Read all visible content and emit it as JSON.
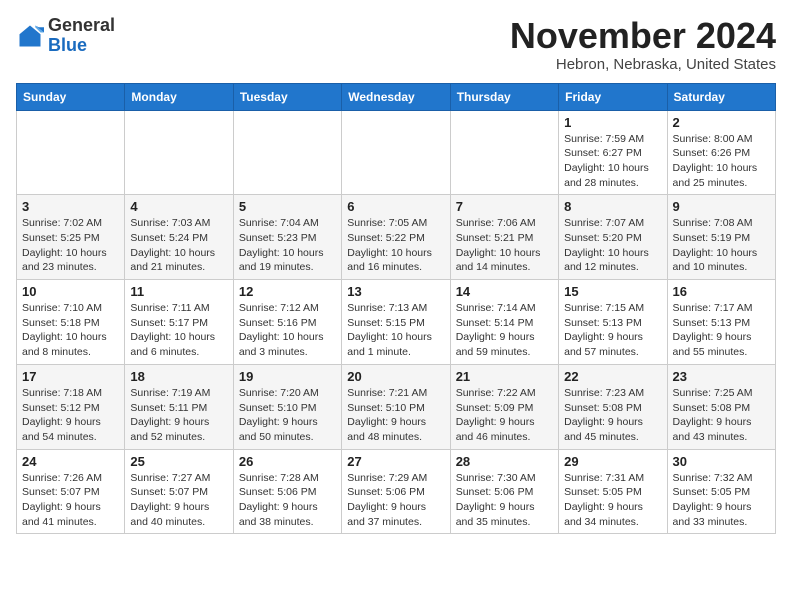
{
  "header": {
    "logo_line1": "General",
    "logo_line2": "Blue",
    "month_title": "November 2024",
    "location": "Hebron, Nebraska, United States"
  },
  "weekdays": [
    "Sunday",
    "Monday",
    "Tuesday",
    "Wednesday",
    "Thursday",
    "Friday",
    "Saturday"
  ],
  "weeks": [
    [
      {
        "day": "",
        "info": ""
      },
      {
        "day": "",
        "info": ""
      },
      {
        "day": "",
        "info": ""
      },
      {
        "day": "",
        "info": ""
      },
      {
        "day": "",
        "info": ""
      },
      {
        "day": "1",
        "info": "Sunrise: 7:59 AM\nSunset: 6:27 PM\nDaylight: 10 hours\nand 28 minutes."
      },
      {
        "day": "2",
        "info": "Sunrise: 8:00 AM\nSunset: 6:26 PM\nDaylight: 10 hours\nand 25 minutes."
      }
    ],
    [
      {
        "day": "3",
        "info": "Sunrise: 7:02 AM\nSunset: 5:25 PM\nDaylight: 10 hours\nand 23 minutes."
      },
      {
        "day": "4",
        "info": "Sunrise: 7:03 AM\nSunset: 5:24 PM\nDaylight: 10 hours\nand 21 minutes."
      },
      {
        "day": "5",
        "info": "Sunrise: 7:04 AM\nSunset: 5:23 PM\nDaylight: 10 hours\nand 19 minutes."
      },
      {
        "day": "6",
        "info": "Sunrise: 7:05 AM\nSunset: 5:22 PM\nDaylight: 10 hours\nand 16 minutes."
      },
      {
        "day": "7",
        "info": "Sunrise: 7:06 AM\nSunset: 5:21 PM\nDaylight: 10 hours\nand 14 minutes."
      },
      {
        "day": "8",
        "info": "Sunrise: 7:07 AM\nSunset: 5:20 PM\nDaylight: 10 hours\nand 12 minutes."
      },
      {
        "day": "9",
        "info": "Sunrise: 7:08 AM\nSunset: 5:19 PM\nDaylight: 10 hours\nand 10 minutes."
      }
    ],
    [
      {
        "day": "10",
        "info": "Sunrise: 7:10 AM\nSunset: 5:18 PM\nDaylight: 10 hours\nand 8 minutes."
      },
      {
        "day": "11",
        "info": "Sunrise: 7:11 AM\nSunset: 5:17 PM\nDaylight: 10 hours\nand 6 minutes."
      },
      {
        "day": "12",
        "info": "Sunrise: 7:12 AM\nSunset: 5:16 PM\nDaylight: 10 hours\nand 3 minutes."
      },
      {
        "day": "13",
        "info": "Sunrise: 7:13 AM\nSunset: 5:15 PM\nDaylight: 10 hours\nand 1 minute."
      },
      {
        "day": "14",
        "info": "Sunrise: 7:14 AM\nSunset: 5:14 PM\nDaylight: 9 hours\nand 59 minutes."
      },
      {
        "day": "15",
        "info": "Sunrise: 7:15 AM\nSunset: 5:13 PM\nDaylight: 9 hours\nand 57 minutes."
      },
      {
        "day": "16",
        "info": "Sunrise: 7:17 AM\nSunset: 5:13 PM\nDaylight: 9 hours\nand 55 minutes."
      }
    ],
    [
      {
        "day": "17",
        "info": "Sunrise: 7:18 AM\nSunset: 5:12 PM\nDaylight: 9 hours\nand 54 minutes."
      },
      {
        "day": "18",
        "info": "Sunrise: 7:19 AM\nSunset: 5:11 PM\nDaylight: 9 hours\nand 52 minutes."
      },
      {
        "day": "19",
        "info": "Sunrise: 7:20 AM\nSunset: 5:10 PM\nDaylight: 9 hours\nand 50 minutes."
      },
      {
        "day": "20",
        "info": "Sunrise: 7:21 AM\nSunset: 5:10 PM\nDaylight: 9 hours\nand 48 minutes."
      },
      {
        "day": "21",
        "info": "Sunrise: 7:22 AM\nSunset: 5:09 PM\nDaylight: 9 hours\nand 46 minutes."
      },
      {
        "day": "22",
        "info": "Sunrise: 7:23 AM\nSunset: 5:08 PM\nDaylight: 9 hours\nand 45 minutes."
      },
      {
        "day": "23",
        "info": "Sunrise: 7:25 AM\nSunset: 5:08 PM\nDaylight: 9 hours\nand 43 minutes."
      }
    ],
    [
      {
        "day": "24",
        "info": "Sunrise: 7:26 AM\nSunset: 5:07 PM\nDaylight: 9 hours\nand 41 minutes."
      },
      {
        "day": "25",
        "info": "Sunrise: 7:27 AM\nSunset: 5:07 PM\nDaylight: 9 hours\nand 40 minutes."
      },
      {
        "day": "26",
        "info": "Sunrise: 7:28 AM\nSunset: 5:06 PM\nDaylight: 9 hours\nand 38 minutes."
      },
      {
        "day": "27",
        "info": "Sunrise: 7:29 AM\nSunset: 5:06 PM\nDaylight: 9 hours\nand 37 minutes."
      },
      {
        "day": "28",
        "info": "Sunrise: 7:30 AM\nSunset: 5:06 PM\nDaylight: 9 hours\nand 35 minutes."
      },
      {
        "day": "29",
        "info": "Sunrise: 7:31 AM\nSunset: 5:05 PM\nDaylight: 9 hours\nand 34 minutes."
      },
      {
        "day": "30",
        "info": "Sunrise: 7:32 AM\nSunset: 5:05 PM\nDaylight: 9 hours\nand 33 minutes."
      }
    ]
  ]
}
